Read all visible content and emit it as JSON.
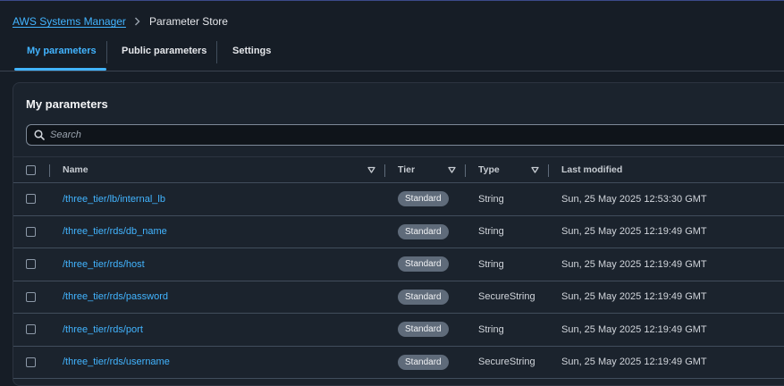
{
  "breadcrumb": {
    "parent": "AWS Systems Manager",
    "current": "Parameter Store"
  },
  "tabs": [
    {
      "label": "My parameters",
      "active": true
    },
    {
      "label": "Public parameters",
      "active": false
    },
    {
      "label": "Settings",
      "active": false
    }
  ],
  "panel": {
    "title": "My parameters",
    "search_placeholder": "Search"
  },
  "table": {
    "headers": {
      "name": "Name",
      "tier": "Tier",
      "type": "Type",
      "last_modified": "Last modified"
    },
    "rows": [
      {
        "name": "/three_tier/lb/internal_lb",
        "tier": "Standard",
        "type": "String",
        "last_modified": "Sun, 25 May 2025 12:53:30 GMT"
      },
      {
        "name": "/three_tier/rds/db_name",
        "tier": "Standard",
        "type": "String",
        "last_modified": "Sun, 25 May 2025 12:19:49 GMT"
      },
      {
        "name": "/three_tier/rds/host",
        "tier": "Standard",
        "type": "String",
        "last_modified": "Sun, 25 May 2025 12:19:49 GMT"
      },
      {
        "name": "/three_tier/rds/password",
        "tier": "Standard",
        "type": "SecureString",
        "last_modified": "Sun, 25 May 2025 12:19:49 GMT"
      },
      {
        "name": "/three_tier/rds/port",
        "tier": "Standard",
        "type": "String",
        "last_modified": "Sun, 25 May 2025 12:19:49 GMT"
      },
      {
        "name": "/three_tier/rds/username",
        "tier": "Standard",
        "type": "SecureString",
        "last_modified": "Sun, 25 May 2025 12:19:49 GMT"
      }
    ]
  },
  "colors": {
    "accent": "#42b4ff",
    "background": "#161d26",
    "panel": "#1b232d",
    "badge": "#5f6b7a"
  }
}
